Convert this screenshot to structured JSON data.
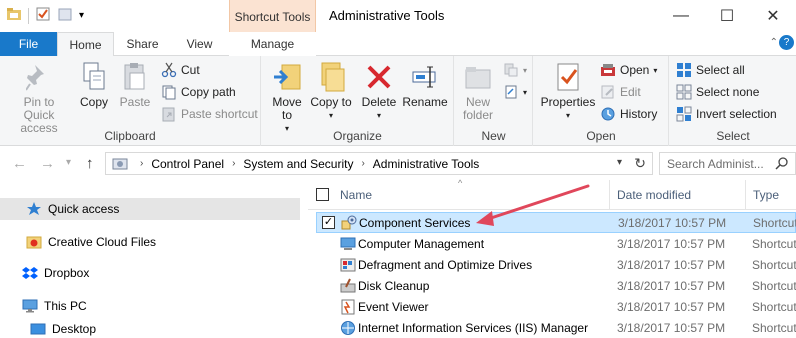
{
  "window": {
    "title": "Administrative Tools",
    "context_tab_header": "Shortcut Tools",
    "minimize": "—",
    "maximize": "☐",
    "close": "✕"
  },
  "tabs": {
    "file": "File",
    "home": "Home",
    "share": "Share",
    "view": "View",
    "manage": "Manage",
    "collapse": "⌃",
    "help": "?"
  },
  "ribbon": {
    "clipboard": {
      "label": "Clipboard",
      "pin": "Pin to Quick access",
      "copy": "Copy",
      "paste": "Paste",
      "cut": "Cut",
      "copy_path": "Copy path",
      "paste_shortcut": "Paste shortcut"
    },
    "organize": {
      "label": "Organize",
      "move_to": "Move to",
      "copy_to": "Copy to",
      "delete": "Delete",
      "rename": "Rename"
    },
    "new": {
      "label": "New",
      "new_folder": "New folder"
    },
    "open": {
      "label": "Open",
      "properties": "Properties",
      "open": "Open",
      "edit": "Edit",
      "history": "History"
    },
    "select": {
      "label": "Select",
      "select_all": "Select all",
      "select_none": "Select none",
      "invert": "Invert selection"
    }
  },
  "address": {
    "crumbs": [
      "Control Panel",
      "System and Security",
      "Administrative Tools"
    ],
    "search_placeholder": "Search Administ..."
  },
  "nav": {
    "items": [
      {
        "label": "Quick access",
        "icon": "star-icon"
      },
      {
        "label": "Creative Cloud Files",
        "icon": "creative-cloud-icon"
      },
      {
        "label": "Dropbox",
        "icon": "dropbox-icon"
      },
      {
        "label": "This PC",
        "icon": "computer-icon"
      },
      {
        "label": "Desktop",
        "icon": "desktop-icon"
      }
    ]
  },
  "filelist": {
    "columns": {
      "name": "Name",
      "date": "Date modified",
      "type": "Type"
    },
    "rows": [
      {
        "name": "Component Services",
        "date": "3/18/2017 10:57 PM",
        "type": "Shortcut",
        "selected": true
      },
      {
        "name": "Computer Management",
        "date": "3/18/2017 10:57 PM",
        "type": "Shortcut"
      },
      {
        "name": "Defragment and Optimize Drives",
        "date": "3/18/2017 10:57 PM",
        "type": "Shortcut"
      },
      {
        "name": "Disk Cleanup",
        "date": "3/18/2017 10:57 PM",
        "type": "Shortcut"
      },
      {
        "name": "Event Viewer",
        "date": "3/18/2017 10:57 PM",
        "type": "Shortcut"
      },
      {
        "name": "Internet Information Services (IIS) Manager",
        "date": "3/18/2017 10:57 PM",
        "type": "Shortcut"
      }
    ]
  },
  "colors": {
    "accent": "#1979ca",
    "selection": "#cce8ff",
    "annotation_arrow": "#e0475b"
  }
}
